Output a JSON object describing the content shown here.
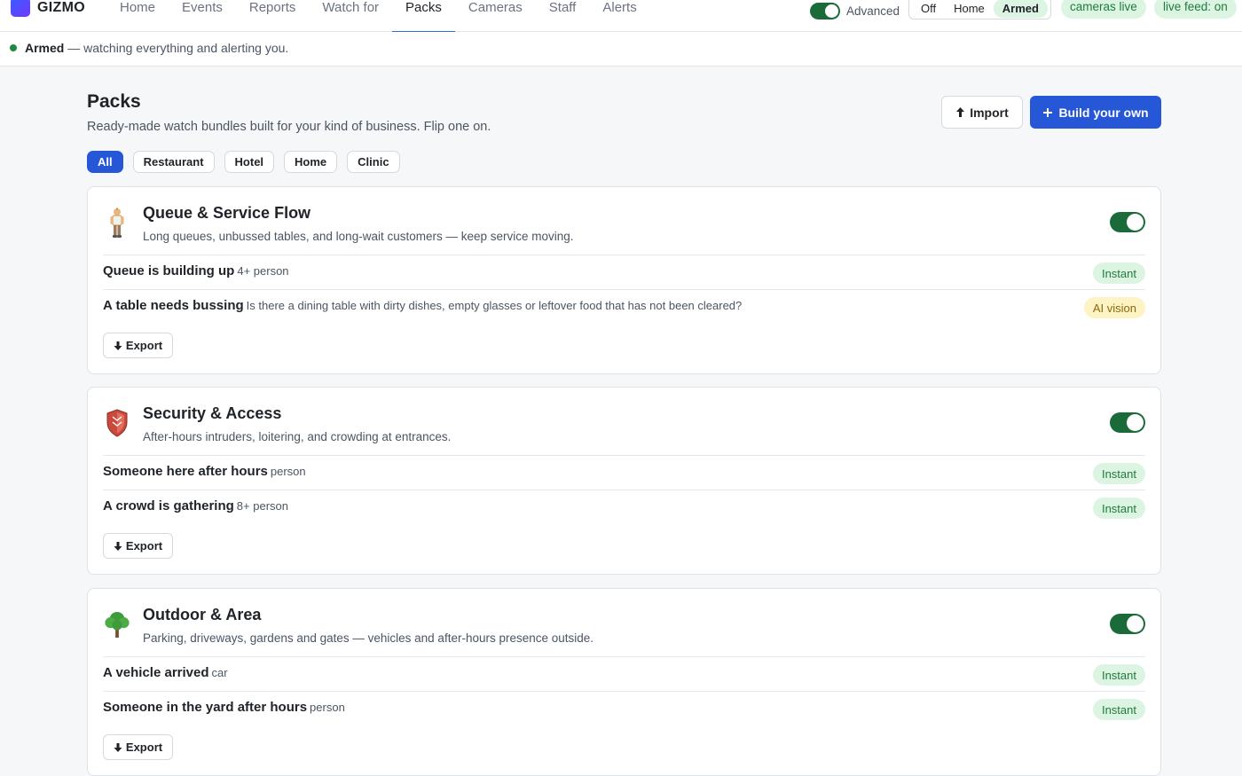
{
  "app": {
    "brand": "GIZMO"
  },
  "nav": {
    "items": [
      {
        "label": "Home"
      },
      {
        "label": "Events"
      },
      {
        "label": "Reports"
      },
      {
        "label": "Watch for"
      },
      {
        "label": "Packs"
      },
      {
        "label": "Cameras"
      },
      {
        "label": "Staff"
      },
      {
        "label": "Alerts"
      }
    ],
    "active_index": 4
  },
  "header_controls": {
    "advanced_label": "Advanced",
    "advanced_on": true,
    "modes": [
      "Off",
      "Home",
      "Armed"
    ],
    "selected_mode": "Armed",
    "cameras_pill": "cameras live",
    "feed_pill": "live feed: on"
  },
  "status": {
    "state": "Armed",
    "message": " — watching everything and alerting you."
  },
  "page": {
    "title": "Packs",
    "subtitle": "Ready-made watch bundles built for your kind of business. Flip one on.",
    "import_label": "Import",
    "build_label": "Build your own",
    "filters": [
      "All",
      "Restaurant",
      "Hotel",
      "Home",
      "Clinic"
    ],
    "active_filter": "All"
  },
  "packs": [
    {
      "icon": "person-standing-icon",
      "title": "Queue & Service Flow",
      "description": "Long queues, unbussed tables, and long-wait customers — keep service moving.",
      "enabled": true,
      "rules": [
        {
          "name": "Queue is building up",
          "hint": "4+ person",
          "badge": "Instant"
        },
        {
          "name": "A table needs bussing",
          "hint": "Is there a dining table with dirty dishes, empty glasses or leftover food that has not been cleared?",
          "badge": "AI vision"
        }
      ],
      "export_label": "Export"
    },
    {
      "icon": "shield-icon",
      "title": "Security & Access",
      "description": "After-hours intruders, loitering, and crowding at entrances.",
      "enabled": true,
      "rules": [
        {
          "name": "Someone here after hours",
          "hint": "person",
          "badge": "Instant"
        },
        {
          "name": "A crowd is gathering",
          "hint": "8+ person",
          "badge": "Instant"
        }
      ],
      "export_label": "Export"
    },
    {
      "icon": "tree-icon",
      "title": "Outdoor & Area",
      "description": "Parking, driveways, gardens and gates — vehicles and after-hours presence outside.",
      "enabled": true,
      "rules": [
        {
          "name": "A vehicle arrived",
          "hint": "car",
          "badge": "Instant"
        },
        {
          "name": "Someone in the yard after hours",
          "hint": "person",
          "badge": "Instant"
        }
      ],
      "export_label": "Export"
    }
  ],
  "colors": {
    "primary": "#2557d6",
    "toggle_on": "#1b6b3a",
    "instant_bg": "#dcf5e2",
    "instant_fg": "#217a3c",
    "ai_bg": "#fdf3c4",
    "ai_fg": "#8a6a0a"
  }
}
